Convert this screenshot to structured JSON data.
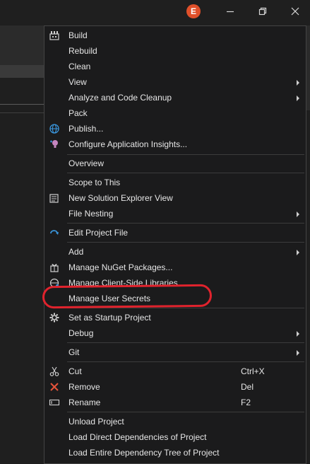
{
  "window": {
    "avatar_initial": "E",
    "controls": [
      "minimize-icon",
      "restore-icon",
      "close-icon"
    ]
  },
  "menu": {
    "items": [
      {
        "label": "Build",
        "icon": "build-icon"
      },
      {
        "label": "Rebuild"
      },
      {
        "label": "Clean"
      },
      {
        "label": "View",
        "submenu": true
      },
      {
        "label": "Analyze and Code Cleanup",
        "submenu": true
      },
      {
        "label": "Pack"
      },
      {
        "label": "Publish...",
        "icon": "globe-icon"
      },
      {
        "label": "Configure Application Insights...",
        "icon": "lightbulb-icon"
      },
      {
        "label": "Overview"
      },
      {
        "label": "Scope to This"
      },
      {
        "label": "New Solution Explorer View",
        "icon": "new-view-icon"
      },
      {
        "label": "File Nesting",
        "submenu": true
      },
      {
        "label": "Edit Project File",
        "icon": "edit-project-icon"
      },
      {
        "label": "Add",
        "submenu": true
      },
      {
        "label": "Manage NuGet Packages...",
        "icon": "nuget-icon"
      },
      {
        "label": "Manage Client-Side Libraries...",
        "icon": "libraries-icon"
      },
      {
        "label": "Manage User Secrets"
      },
      {
        "label": "Set as Startup Project",
        "icon": "gear-icon"
      },
      {
        "label": "Debug",
        "submenu": true
      },
      {
        "label": "Git",
        "submenu": true
      },
      {
        "label": "Cut",
        "icon": "scissors-icon",
        "shortcut": "Ctrl+X"
      },
      {
        "label": "Remove",
        "icon": "remove-icon",
        "shortcut": "Del"
      },
      {
        "label": "Rename",
        "icon": "rename-icon",
        "shortcut": "F2"
      },
      {
        "label": "Unload Project"
      },
      {
        "label": "Load Direct Dependencies of Project"
      },
      {
        "label": "Load Entire Dependency Tree of Project"
      }
    ]
  },
  "colors": {
    "menu_bg": "#1b1b1c",
    "annotation_red": "#e0232d",
    "avatar": "#e0502a",
    "accent_blue": "#3a96dd"
  }
}
